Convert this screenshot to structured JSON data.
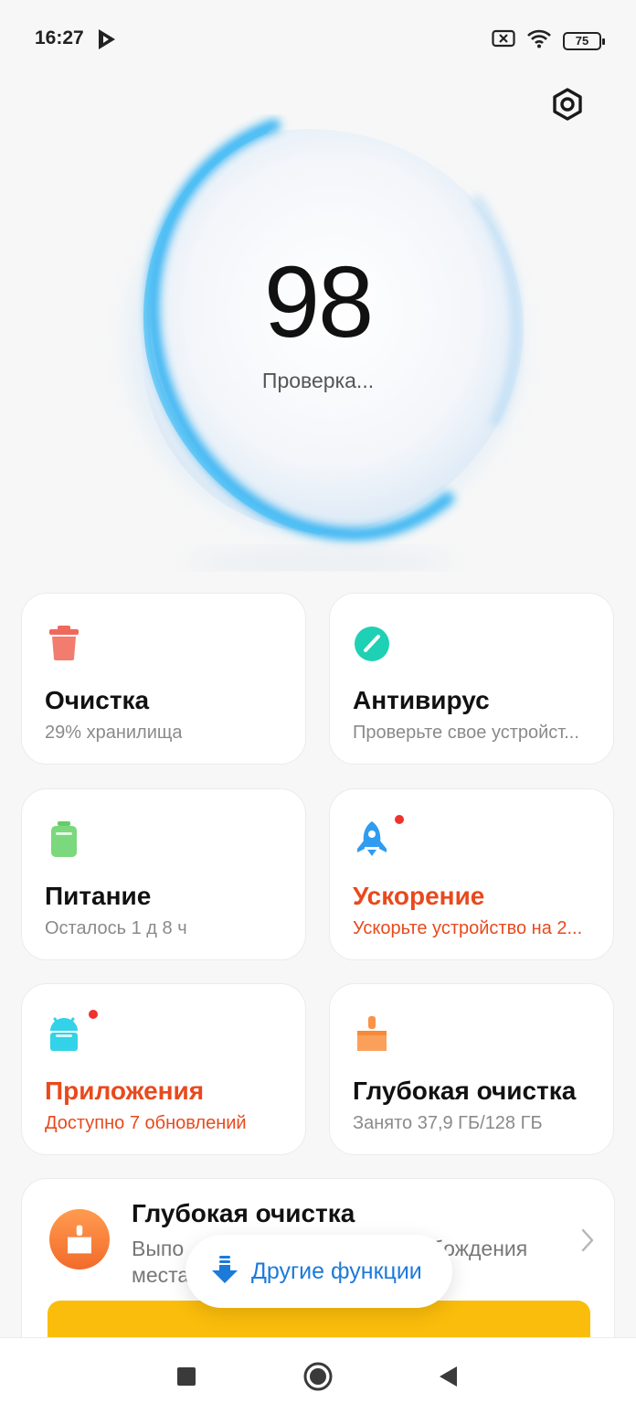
{
  "status_bar": {
    "time": "16:27",
    "battery": "75",
    "icons": [
      "play-store-icon",
      "sim-off-icon",
      "wifi-icon",
      "battery-icon"
    ]
  },
  "header": {
    "settings_icon": "gear-icon"
  },
  "score": {
    "value": "98",
    "status": "Проверка..."
  },
  "cards": [
    {
      "title": "Очистка",
      "subtitle": "29% хранилища",
      "icon": "trash-icon",
      "icon_color": "#f0675b",
      "alert": false
    },
    {
      "title": "Антивирус",
      "subtitle": "Проверьте свое устройст...",
      "icon": "shield-gauge-icon",
      "icon_color": "#1ed1b4",
      "alert": false
    },
    {
      "title": "Питание",
      "subtitle": "Осталось 1 д 8 ч",
      "icon": "battery-icon",
      "icon_color": "#66cc6a",
      "alert": false
    },
    {
      "title": "Ускорение",
      "subtitle": "Ускорьте устройство на 2...",
      "icon": "rocket-icon",
      "icon_color": "#2f9cf0",
      "alert": true
    },
    {
      "title": "Приложения",
      "subtitle": "Доступно 7 обновлений",
      "icon": "android-icon",
      "icon_color": "#32d3e8",
      "alert": true
    },
    {
      "title": "Глубокая очистка",
      "subtitle": "Занято 37,9 ГБ/128 ГБ",
      "icon": "broom-icon",
      "icon_color": "#f99347",
      "alert": false
    }
  ],
  "wide_card": {
    "title": "Глубокая очистка",
    "description_visible_start": "Выпо",
    "description_visible_mid": "обождения",
    "description_visible_line2": "места",
    "icon": "broom-icon",
    "banner_color": "#fbbd0b"
  },
  "more_functions": {
    "label": "Другие функции",
    "icon": "download-arrow-icon",
    "accent": "#1c7ad9"
  },
  "alert_color": "#e84a1d",
  "nav": {
    "recents_icon": "square-icon",
    "home_icon": "circle-icon",
    "back_icon": "triangle-back-icon"
  }
}
